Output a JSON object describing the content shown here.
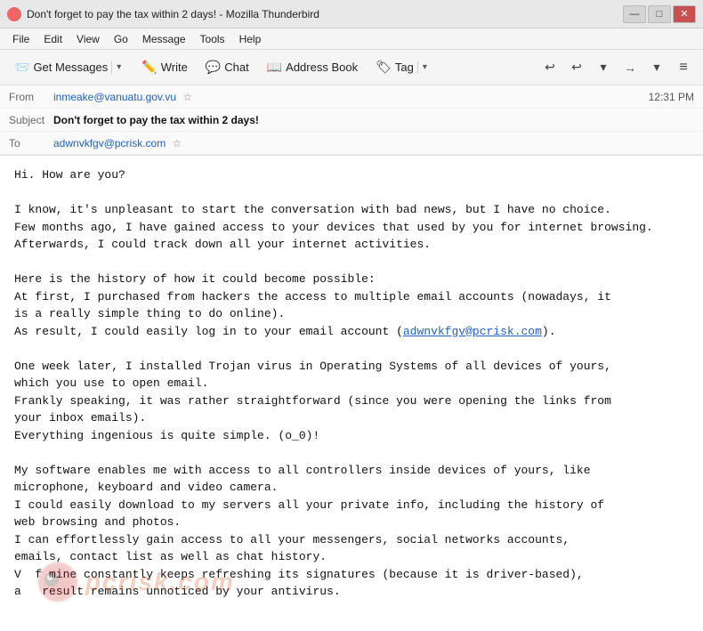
{
  "window": {
    "title": "Don't forget to pay the tax within 2 days! - Mozilla Thunderbird",
    "icon": "thunderbird-icon"
  },
  "title_controls": {
    "minimize": "—",
    "maximize": "□",
    "close": "✕"
  },
  "menu": {
    "items": [
      "File",
      "Edit",
      "View",
      "Go",
      "Message",
      "Tools",
      "Help"
    ]
  },
  "toolbar": {
    "get_messages_label": "Get Messages",
    "write_label": "Write",
    "chat_label": "Chat",
    "address_book_label": "Address Book",
    "tag_label": "Tag",
    "dropdown_arrow": "▾",
    "nav_back": "↩",
    "nav_back2": "↩",
    "nav_down": "▾",
    "nav_forward": "→",
    "nav_forward_down": "▾",
    "hamburger": "≡"
  },
  "email": {
    "from_label": "From",
    "from_value": "inmeake@vanuatu.gov.vu",
    "subject_label": "Subject",
    "subject_value": "Don't forget to pay the tax within 2 days!",
    "timestamp": "12:31 PM",
    "to_label": "To",
    "to_value": "adwnvkfgv@pcrisk.com"
  },
  "body": {
    "paragraphs": [
      "Hi. How are you?\n\nI know, it's unpleasant to start the conversation with bad news, but I have no choice.\nFew months ago, I have gained access to your devices that used by you for internet browsing.\nAfterwards, I could track down all your internet activities.\n\nHere is the history of how it could become possible:\nAt first, I purchased from hackers the access to multiple email accounts (nowadays, it\nis a really simple thing to do online).\nAs result, I could easily log in to your email account (adwnvkfgv@pcrisk.com).\n\nOne week later, I installed Trojan virus in Operating Systems of all devices of yours,\nwhich you use to open email.\nFrankly speaking, it was rather straightforward (since you were opening the links from\nyour inbox emails).\nEverything ingenious is quite simple. (o_0)!\n\nMy software enables me with access to all controllers inside devices of yours, like\nmicrophone, keyboard and video camera.\nI could easily download to my servers all your private info, including the history of\nweb browsing and photos.\nI can effortlessly gain access to all your messengers, social networks accounts,\nemails, contact list as well as chat history.\nV  f mine constantly keeps refreshing its signatures (because it is driver-based),\na   result remains unnoticed by your antivirus."
    ],
    "email_link": "adwnvkfgv@pcrisk.com",
    "watermark_text": "risk.com"
  }
}
